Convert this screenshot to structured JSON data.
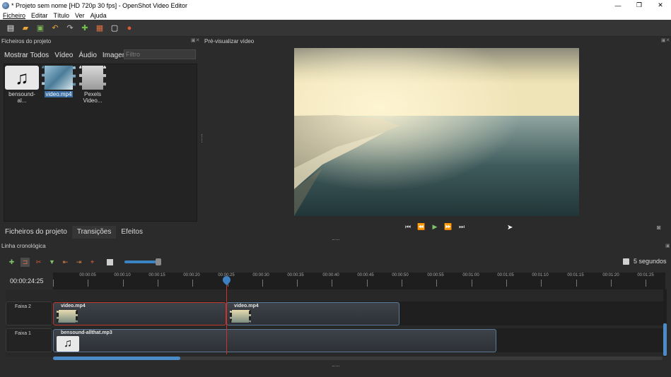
{
  "window": {
    "title": "* Projeto sem nome [HD 720p 30 fps] - OpenShot Video Editor"
  },
  "menu": [
    "Ficheiro",
    "Editar",
    "Título",
    "Ver",
    "Ajuda"
  ],
  "toolbar_icons": [
    "new-project-icon",
    "open-project-icon",
    "save-project-icon",
    "undo-icon",
    "redo-icon",
    "import-files-icon",
    "profile-icon",
    "fullscreen-icon",
    "export-icon"
  ],
  "files_panel": {
    "title": "Ficheiros do projeto",
    "filter_tabs": [
      "Mostrar Todos",
      "Vídeo",
      "Áudio",
      "Imagem"
    ],
    "filter_placeholder": "Filtro",
    "files": [
      {
        "name": "bensound-al...",
        "type": "audio"
      },
      {
        "name": "video.mp4",
        "type": "video",
        "selected": true
      },
      {
        "name": "Pexels Video...",
        "type": "video"
      }
    ]
  },
  "preview_panel": {
    "title": "Pré-visualizar vídeo"
  },
  "bottom_tabs": [
    "Ficheiros do projeto",
    "Transições",
    "Efeitos"
  ],
  "timeline": {
    "title": "Linha cronológica",
    "timecode": "00:00:24:25",
    "zoom_label": "5 segundos",
    "ruler_labels": [
      "00:00:05",
      "00:00:10",
      "00:00:15",
      "00:00:20",
      "00:00:25",
      "00:00:30",
      "00:00:35",
      "00:00:40",
      "00:00:45",
      "00:00:50",
      "00:00:55",
      "00:01:00",
      "00:01:05",
      "00:01:10",
      "00:01:15",
      "00:01:20",
      "00:01:25"
    ],
    "tracks": [
      {
        "name": "Faixa 2",
        "clips": [
          "video.mp4",
          "video.mp4"
        ]
      },
      {
        "name": "Faixa 1",
        "clips": [
          "bensound-allthat.mp3"
        ]
      }
    ]
  }
}
